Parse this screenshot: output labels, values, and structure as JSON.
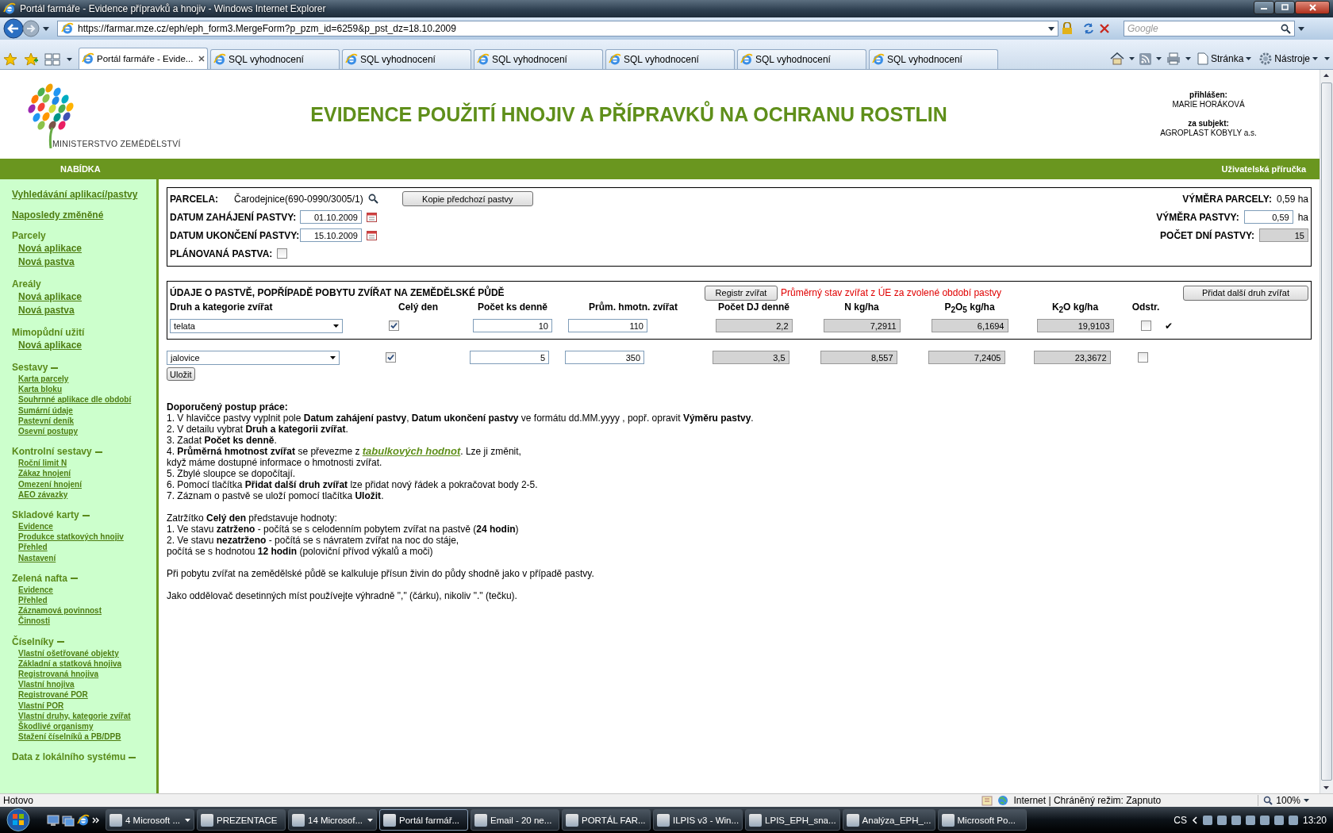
{
  "window": {
    "title": "Portál farmáře - Evidence přípravků a hnojiv - Windows Internet Explorer"
  },
  "address_bar": {
    "url": "https://farmar.mze.cz/eph/eph_form3.MergeForm?p_pzm_id=6259&p_pst_dz=18.10.2009",
    "search_placeholder": "Google"
  },
  "tabs": [
    {
      "label": "Portál farmáře - Evide...",
      "selected": true
    },
    {
      "label": "SQL vyhodnocení",
      "selected": false
    },
    {
      "label": "SQL vyhodnocení",
      "selected": false
    },
    {
      "label": "SQL vyhodnocení",
      "selected": false
    },
    {
      "label": "SQL vyhodnocení",
      "selected": false
    },
    {
      "label": "SQL vyhodnocení",
      "selected": false
    },
    {
      "label": "SQL vyhodnocení",
      "selected": false
    }
  ],
  "command_bar": {
    "page_menu": "Stránka",
    "tools_menu": "Nástroje"
  },
  "header": {
    "logo_text": "MINISTERSTVO ZEMĚDĚLSTVÍ",
    "title": "EVIDENCE POUŽITÍ HNOJIV A PŘÍPRAVKŮ NA OCHRANU ROSTLIN",
    "logged_in_label": "přihlášen:",
    "user": "MARIE HORÁKOVÁ",
    "subject_label": "za subjekt:",
    "subject": "AGROPLAST KOBYLY a.s."
  },
  "nav": {
    "menu": "NABÍDKA",
    "manual": "Uživatelská příručka"
  },
  "sidebar": {
    "top_links": [
      "Vyhledávání aplikací/pastvy",
      "Naposledy změněné"
    ],
    "sections": [
      {
        "title": "Parcely",
        "kind": "group",
        "items": [
          "Nová aplikace",
          "Nová pastva"
        ]
      },
      {
        "title": "Areály",
        "kind": "group",
        "items": [
          "Nová aplikace",
          "Nová pastva"
        ]
      },
      {
        "title": "Mimopůdní užití",
        "kind": "group",
        "items": [
          "Nová aplikace"
        ]
      },
      {
        "title": "Sestavy",
        "kind": "collapsible",
        "expanded": true,
        "items": [
          "Karta parcely",
          "Karta bloku",
          "Souhrnné aplikace dle období",
          "Sumární údaje",
          "Pastevní deník",
          "Osevní postupy"
        ]
      },
      {
        "title": "Kontrolní sestavy",
        "kind": "collapsible",
        "expanded": true,
        "items": [
          "Roční limit N",
          "Zákaz hnojení",
          "Omezení hnojení",
          "AEO závazky"
        ]
      },
      {
        "title": "Skladové karty",
        "kind": "collapsible",
        "expanded": true,
        "items": [
          "Evidence",
          "Produkce statkových hnojiv",
          "Přehled",
          "Nastavení"
        ]
      },
      {
        "title": "Zelená nafta",
        "kind": "collapsible",
        "expanded": true,
        "items": [
          "Evidence",
          "Přehled",
          "Záznamová povinnost",
          "Činnosti"
        ]
      },
      {
        "title": "Číselníky",
        "kind": "collapsible",
        "expanded": true,
        "items": [
          "Vlastní ošetřované objekty",
          "Základní a statková hnojiva",
          "Registrovaná hnojiva",
          "Vlastní hnojiva",
          "Registrované POR",
          "Vlastní POR",
          "Vlastní druhy, kategorie zvířat",
          "Škodlivé organismy",
          "Stažení číselníků a PB/DPB"
        ]
      },
      {
        "title": "Data z lokálního systému",
        "kind": "collapsible",
        "expanded": true
      }
    ]
  },
  "pasture": {
    "parcel_label": "PARCELA:",
    "parcel": "Čarodejnice(690-0990/3005/1)",
    "copy_button": "Kopie předchozí pastvy",
    "start_label": "DATUM ZAHÁJENÍ PASTVY:",
    "start_date": "01.10.2009",
    "end_label": "DATUM UKONČENÍ PASTVY:",
    "end_date": "15.10.2009",
    "planned_label": "PLÁNOVANÁ PASTVA:",
    "planned": false,
    "parcel_area_label": "VÝMĚRA PARCELY:",
    "parcel_area": "0,59 ha",
    "area_label": "VÝMĚRA PASTVY:",
    "area": "0,59",
    "area_unit": "ha",
    "days_label": "POČET DNÍ PASTVY:",
    "days": "15"
  },
  "animals": {
    "title": "ÚDAJE O PASTVĚ, POPŘÍPADĚ POBYTU ZVÍŘAT NA ZEMĚDĚLSKÉ PŮDĚ",
    "registry_button": "Registr zvířat",
    "note": "Průměrný stav zvířat z ÚE za zvolené období pastvy",
    "add_button": "Přidat další druh zvířat",
    "columns": [
      "Druh a kategorie zvířat",
      "Celý den",
      "Počet ks denně",
      "Prům. hmotn. zvířat",
      "Počet DJ denně",
      "N kg/ha",
      "P$_{2}$O$_{5}$ kg/ha",
      "K$_{2}$O kg/ha",
      "Odstr."
    ],
    "rows": [
      {
        "category": "telata",
        "whole_day": true,
        "count": "10",
        "weight": "110",
        "dj": "2,2",
        "n": "7,2911",
        "p2o5": "6,1694",
        "k2o": "19,9103",
        "remove": false,
        "status": "✔"
      },
      {
        "category": "jalovice",
        "whole_day": true,
        "count": "5",
        "weight": "350",
        "dj": "3,5",
        "n": "8,557",
        "p2o5": "7,2405",
        "k2o": "23,3672",
        "remove": false
      }
    ],
    "save_button": "Uložit"
  },
  "help": {
    "title": "Doporučený postup práce:",
    "paragraphs": [
      [
        {
          "text": "1. V hlavičce pastvy vyplnit pole **Datum zahájení pastvy**, **Datum ukončení pastvy** ve formátu dd.MM.yyyy , popř. opravit **Výměru pastvy**."
        },
        {
          "text": "2. V detailu vybrat **Druh a kategorii zvířat**."
        },
        {
          "text": "3. Zadat **Počet ks denně**."
        },
        {
          "text": "4. **Průměrná hmotnost zvířat** se převezme z ",
          "link": "tabulkových hodnot",
          "after": ". Lze ji změnit,"
        },
        {
          "text": "když máme dostupné informace o hmotnosti zvířat."
        },
        {
          "text": "5. Zbylé sloupce se dopočítají."
        },
        {
          "text": "6. Pomocí tlačítka **Přidat další druh zvířat** lze přidat nový řádek a pokračovat body 2-5."
        },
        {
          "text": "7. Záznam o pastvě se uloží pomocí tlačítka **Uložit**."
        }
      ],
      [
        {
          "text": "Zatržítko **Celý den** představuje hodnoty:"
        },
        {
          "text": "1. Ve stavu **zatrženo** - počítá se s celodenním pobytem zvířat na pastvě (**24 hodin**)"
        },
        {
          "text": "2. Ve stavu **nezatrženo** - počítá se s návratem zvířat na noc do stáje,"
        },
        {
          "text": "počítá se s hodnotou **12 hodin** (poloviční přívod výkalů a moči)"
        }
      ],
      [
        {
          "text": "Při pobytu zvířat na zemědělské půdě se kalkuluje přísun živin do půdy shodně jako v případě pastvy."
        }
      ],
      [
        {
          "text": "Jako oddělovač desetinných míst používejte výhradně \",\" (čárku), nikoliv \".\" (tečku)."
        }
      ]
    ]
  },
  "status_bar": {
    "status": "Hotovo",
    "zone": "Internet | Chráněný režim: Zapnuto",
    "zoom": "100%"
  },
  "taskbar": {
    "items": [
      {
        "label": "4 Microsoft ...",
        "grouped": true,
        "selected": false
      },
      {
        "label": "PREZENTACE",
        "grouped": false,
        "selected": false
      },
      {
        "label": "14 Microsof...",
        "grouped": true,
        "selected": false
      },
      {
        "label": "Portál farmář...",
        "grouped": false,
        "selected": true
      },
      {
        "label": "Email - 20 ne...",
        "grouped": false,
        "selected": false
      },
      {
        "label": "PORTÁL FAR...",
        "grouped": false,
        "selected": false
      },
      {
        "label": "ILPIS v3 - Win...",
        "grouped": false,
        "selected": false
      },
      {
        "label": "LPIS_EPH_sna...",
        "grouped": false,
        "selected": false
      },
      {
        "label": "Analýza_EPH_...",
        "grouped": false,
        "selected": false
      },
      {
        "label": "Microsoft Po...",
        "grouped": false,
        "selected": false
      }
    ],
    "language": "CS",
    "clock": "13:20"
  }
}
